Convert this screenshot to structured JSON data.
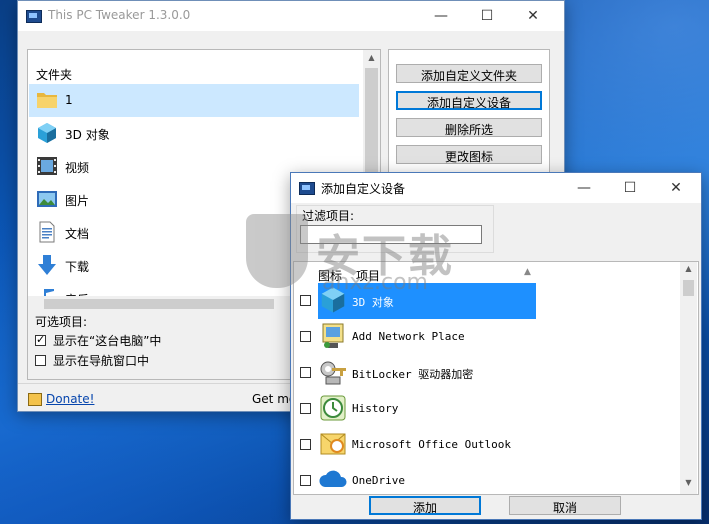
{
  "main_window": {
    "title": "This PC Tweaker 1.3.0.0",
    "minimize": "—",
    "maximize": "☐",
    "close": "✕",
    "folders_header": "文件夹",
    "folders": [
      {
        "label": "1",
        "icon": "folder-icon",
        "selected": true
      },
      {
        "label": "3D 对象",
        "icon": "3d-objects-icon",
        "selected": false
      },
      {
        "label": "视频",
        "icon": "video-icon",
        "selected": false
      },
      {
        "label": "图片",
        "icon": "pictures-icon",
        "selected": false
      },
      {
        "label": "文档",
        "icon": "documents-icon",
        "selected": false
      },
      {
        "label": "下载",
        "icon": "download-icon",
        "selected": false
      },
      {
        "label": "音乐",
        "icon": "music-icon",
        "selected": false
      }
    ],
    "buttons": {
      "add_custom_folder": "添加自定义文件夹",
      "add_custom_device": "添加自定义设备",
      "delete_selected": "删除所选",
      "change_icon": "更改图标"
    },
    "options_header": "可选项目:",
    "options": [
      {
        "label": "显示在“这台电脑”中",
        "checked": true
      },
      {
        "label": "显示在导航窗口中",
        "checked": false
      }
    ],
    "donate": "Donate!",
    "get_more": "Get mo"
  },
  "dialog": {
    "title": "添加自定义设备",
    "minimize": "—",
    "maximize": "☐",
    "close": "✕",
    "filter_label": "过滤项目:",
    "filter_value": "",
    "col_icon": "图标",
    "col_item": "项目",
    "items": [
      {
        "label": "3D 对象",
        "icon": "3d-objects-icon",
        "checked": false,
        "selected": true
      },
      {
        "label": "Add Network Place",
        "icon": "network-place-icon",
        "checked": false,
        "selected": false
      },
      {
        "label": "BitLocker 驱动器加密",
        "icon": "bitlocker-icon",
        "checked": false,
        "selected": false
      },
      {
        "label": "History",
        "icon": "history-icon",
        "checked": false,
        "selected": false
      },
      {
        "label": "Microsoft Office Outlook",
        "icon": "outlook-icon",
        "checked": false,
        "selected": false
      },
      {
        "label": "OneDrive",
        "icon": "onedrive-icon",
        "checked": false,
        "selected": false
      }
    ],
    "add_button": "添加",
    "cancel_button": "取消"
  },
  "watermark": "安下载",
  "watermark_url": "anxz.com",
  "colors": {
    "selection": "#cce8ff",
    "highlight": "#1e90ff",
    "focus": "#0078d7"
  }
}
